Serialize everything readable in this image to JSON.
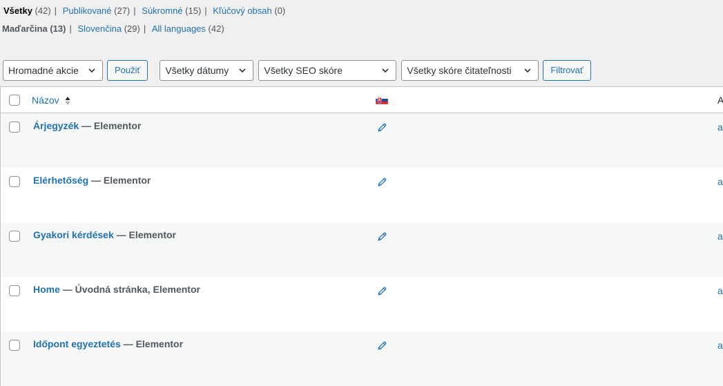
{
  "status_filters": [
    {
      "label": "Všetky",
      "count": "(42)",
      "current": true
    },
    {
      "label": "Publikované",
      "count": "(27)",
      "current": false
    },
    {
      "label": "Súkromné",
      "count": "(15)",
      "current": false
    },
    {
      "label": "Kľúčový obsah",
      "count": "(0)",
      "current": false
    }
  ],
  "language_filters": [
    {
      "label": "Maďarčina",
      "count": "(13)",
      "current": true
    },
    {
      "label": "Slovenčina",
      "count": "(29)",
      "current": false
    },
    {
      "label": "All languages",
      "count": "(42)",
      "current": false
    }
  ],
  "separator": "|",
  "bulk_actions": {
    "selected": "Hromadné akcie",
    "apply_label": "Použiť"
  },
  "filters": {
    "dates": "Všetky dátumy",
    "seo": "Všetky SEO skóre",
    "readability": "Všetky skóre čitateľnosti",
    "filter_label": "Filtrovať"
  },
  "table": {
    "columns": {
      "title": "Názov",
      "language_flag": "slovak-flag-icon",
      "author": "A"
    },
    "rows": [
      {
        "title": "Árjegyzék",
        "state": "— Elementor",
        "author": "ac"
      },
      {
        "title": "Elérhetőség",
        "state": "— Elementor",
        "author": "ac"
      },
      {
        "title": "Gyakori kérdések",
        "state": "— Elementor",
        "author": "ac"
      },
      {
        "title": "Home",
        "state": "— Úvodná stránka, Elementor",
        "author": "ac"
      },
      {
        "title": "Időpont egyeztetés",
        "state": "— Elementor",
        "author": "ac"
      }
    ]
  },
  "colors": {
    "link": "#2271b1",
    "background": "#f0f0f1",
    "row_alt": "#f6f7f7"
  }
}
